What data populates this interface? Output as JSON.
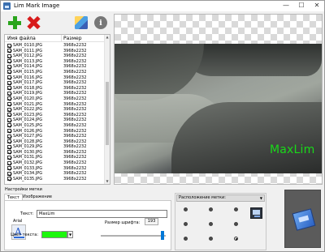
{
  "window": {
    "title": "Lim Mark Image",
    "minimize": "—",
    "maximize": "☐",
    "close": "✕"
  },
  "toolbar": {
    "add_icon": "plus-icon",
    "remove_icon": "x-icon",
    "settings_icon": "brush-icon",
    "about_icon": "info-icon"
  },
  "filelist": {
    "col_name": "Имя файла",
    "col_size": "Размер",
    "rows": [
      {
        "name": "SAM_0110.JPG",
        "size": "3968x2232"
      },
      {
        "name": "SAM_0111.JPG",
        "size": "3968x2232"
      },
      {
        "name": "SAM_0112.JPG",
        "size": "3968x2232"
      },
      {
        "name": "SAM_0113.JPG",
        "size": "3968x2232"
      },
      {
        "name": "SAM_0114.JPG",
        "size": "3968x2232"
      },
      {
        "name": "SAM_0115.JPG",
        "size": "3968x2232"
      },
      {
        "name": "SAM_0116.JPG",
        "size": "3968x2232"
      },
      {
        "name": "SAM_0117.JPG",
        "size": "3968x2232"
      },
      {
        "name": "SAM_0118.JPG",
        "size": "3968x2232"
      },
      {
        "name": "SAM_0119.JPG",
        "size": "3968x2232"
      },
      {
        "name": "SAM_0120.JPG",
        "size": "3968x2232"
      },
      {
        "name": "SAM_0121.JPG",
        "size": "3968x2232"
      },
      {
        "name": "SAM_0122.JPG",
        "size": "3968x2232"
      },
      {
        "name": "SAM_0123.JPG",
        "size": "3968x2232"
      },
      {
        "name": "SAM_0124.JPG",
        "size": "3968x2232"
      },
      {
        "name": "SAM_0125.JPG",
        "size": "3968x2232"
      },
      {
        "name": "SAM_0126.JPG",
        "size": "3968x2232"
      },
      {
        "name": "SAM_0127.JPG",
        "size": "3968x2232"
      },
      {
        "name": "SAM_0128.JPG",
        "size": "3968x2232"
      },
      {
        "name": "SAM_0129.JPG",
        "size": "3968x2232"
      },
      {
        "name": "SAM_0130.JPG",
        "size": "3968x2232"
      },
      {
        "name": "SAM_0131.JPG",
        "size": "3968x2232"
      },
      {
        "name": "SAM_0132.JPG",
        "size": "3968x2232"
      },
      {
        "name": "SAM_0133.JPG",
        "size": "3968x2232"
      },
      {
        "name": "SAM_0134.JPG",
        "size": "3968x2232"
      },
      {
        "name": "SAM_0135.JPG",
        "size": "3968x2232"
      }
    ]
  },
  "preview": {
    "watermark_text": "MaxLim",
    "watermark_color": "#19d919"
  },
  "settings": {
    "group_label": "Настройки метки",
    "tab_text": "Текст",
    "tab_image": "Изображение",
    "text_label": "Текст:",
    "text_value": "MaxLim",
    "font_name": "Arial",
    "size_label": "Размер шрифта:",
    "size_value": "193",
    "color_label": "Цвет текста:",
    "color_value": "#1cf70c",
    "font_icon": "font-icon",
    "opacity_percent": 100
  },
  "position": {
    "label": "Расположение метки:",
    "selected": "bottom-right",
    "apply_icon": "screen-icon"
  },
  "run_button": {
    "icon": "photo-stamp-icon"
  }
}
